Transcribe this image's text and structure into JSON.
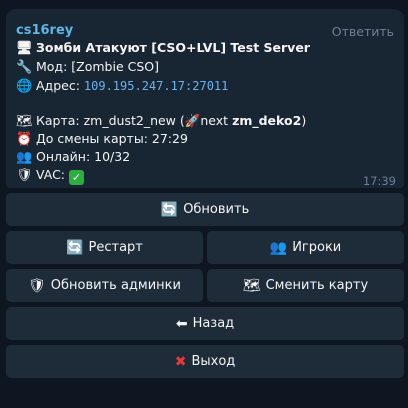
{
  "message": {
    "sender": "cs16rey",
    "reply_label": "Ответить",
    "title_icon": "monitor-icon",
    "title": "Зомби Атакуют [CSO+LVL] Test Server",
    "mod_label": "Мод:",
    "mod_value": "[Zombie CSO]",
    "address_label": "Адрес:",
    "address_value": "109.195.247.17:27011",
    "map_label": "Карта:",
    "map_value": "zm_dust2_new",
    "next_paren_open": "(",
    "next_label": "next",
    "next_map": "zm_deko2",
    "next_paren_close": ")",
    "change_label": "До смены карты:",
    "change_value": "27:29",
    "online_label": "Онлайн:",
    "online_value": "10/32",
    "vac_label": "VAC:",
    "vac_value": "✓",
    "time": "17:39"
  },
  "buttons": {
    "refresh": "Обновить",
    "restart": "Рестарт",
    "players": "Игроки",
    "update_admins": "Обновить админки",
    "change_map": "Сменить карту",
    "back": "Назад",
    "exit": "Выход"
  },
  "colors": {
    "background": "#0e1621",
    "bubble": "#182533",
    "button": "#1e2c3a",
    "sender": "#5fb5e8",
    "link": "#6ab3f3",
    "muted": "#6d8094",
    "vac_badge": "#2cae3f"
  }
}
